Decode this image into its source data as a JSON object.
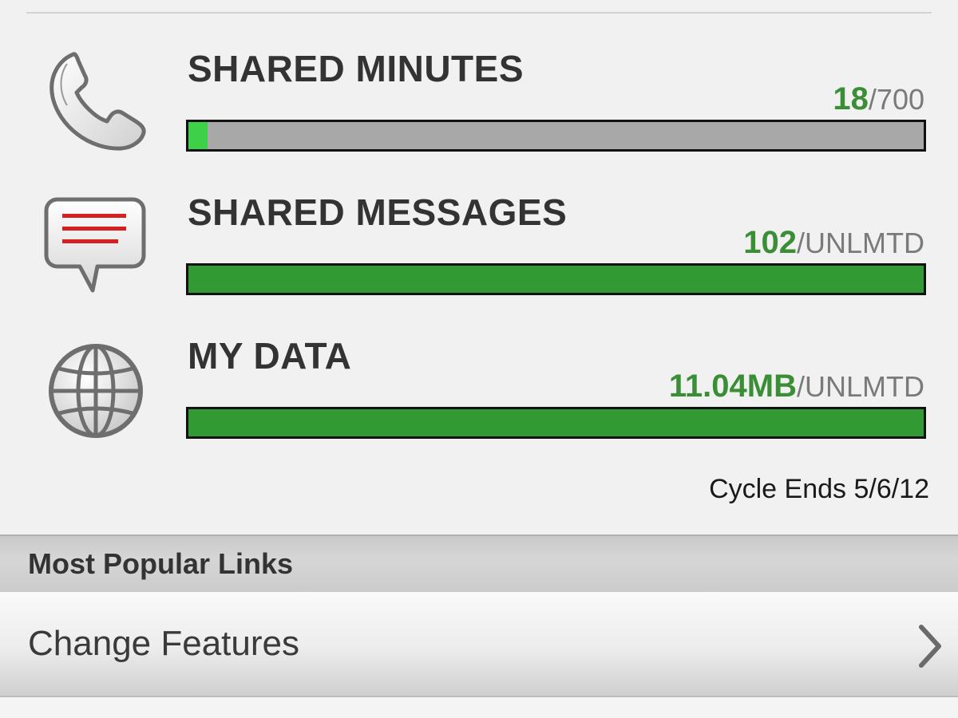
{
  "usage": [
    {
      "icon": "phone-icon",
      "title": "SHARED MINUTES",
      "used": "18",
      "total": "/700",
      "fill_fraction": 0.026
    },
    {
      "icon": "message-icon",
      "title": "SHARED MESSAGES",
      "used": "102",
      "total": "/UNLMTD",
      "fill_fraction": 1.0
    },
    {
      "icon": "globe-icon",
      "title": "MY DATA",
      "used": "11.04MB",
      "total": "/UNLMTD",
      "fill_fraction": 1.0
    }
  ],
  "cycle_ends": "Cycle Ends 5/6/12",
  "popular_links": {
    "header": "Most Popular Links",
    "items": [
      {
        "label": "Change Features"
      }
    ]
  },
  "colors": {
    "used_text": "#3a8f36",
    "bar_fill": "#329a33",
    "bar_fill_low": "#3fd04a",
    "bar_track": "#a8a8a8"
  }
}
